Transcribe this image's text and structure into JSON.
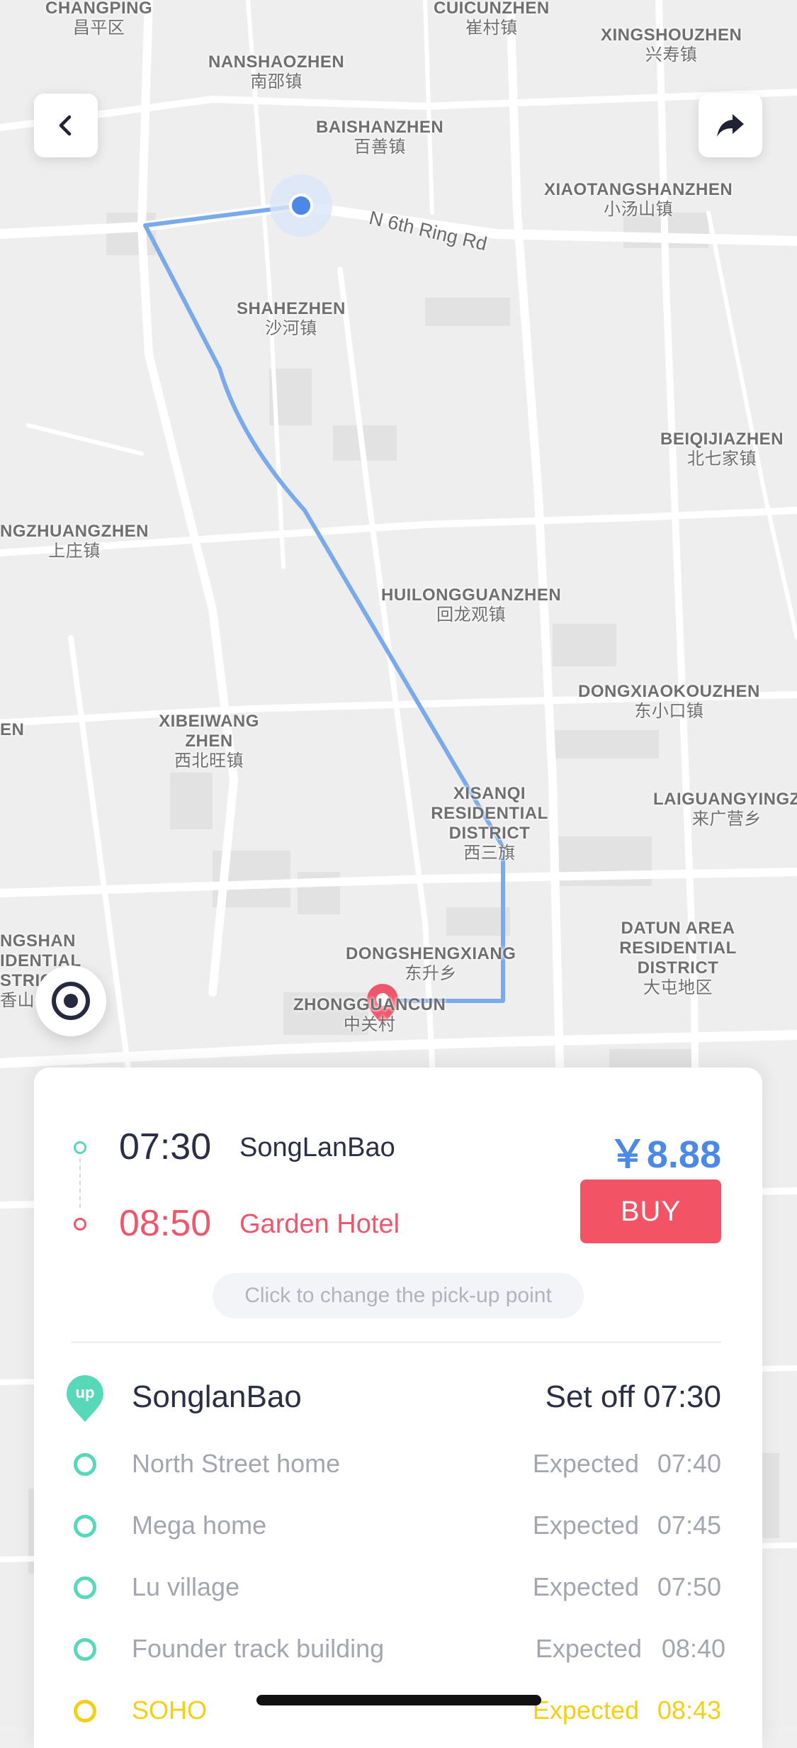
{
  "map": {
    "places": [
      {
        "en": "CHANGPING",
        "cn": "昌平区"
      },
      {
        "en": "CUICUNZHEN",
        "cn": "崔村镇"
      },
      {
        "en": "XINGSHOUZHEN",
        "cn": "兴寿镇"
      },
      {
        "en": "NANSHAOZHEN",
        "cn": "南邵镇"
      },
      {
        "en": "BAISHANZHEN",
        "cn": "百善镇"
      },
      {
        "en": "XIAOTANGSHANZHEN",
        "cn": "小汤山镇"
      },
      {
        "en": "SHAHEZHEN",
        "cn": "沙河镇"
      },
      {
        "en": "BEIQIJIAZHEN",
        "cn": "北七家镇"
      },
      {
        "en": "NGZHUANGZHEN",
        "cn": "上庄镇"
      },
      {
        "en": "HUILONGGUANZHEN",
        "cn": "回龙观镇"
      },
      {
        "en": "DONGXIAOKOUZHEN",
        "cn": "东小口镇"
      },
      {
        "en": "XIBEIWANG ZHEN",
        "cn": "西北旺镇"
      },
      {
        "en": "XISANQI RESIDENTIAL DISTRICT",
        "cn": "西三旗"
      },
      {
        "en": "LAIGUANGYINGZ",
        "cn": "来广营乡"
      },
      {
        "en": "NGSHAN IDENTIAL STRIC",
        "cn": "香山"
      },
      {
        "en": "DONGSHENGXIANG",
        "cn": "东升乡"
      },
      {
        "en": "DATUN AREA RESIDENTIAL DISTRICT",
        "cn": "大屯地区"
      },
      {
        "en": "ZHONGGUANCUN",
        "cn": "中关村"
      },
      {
        "en": "EN",
        "cn": ""
      }
    ],
    "road": "N 6th Ring Rd"
  },
  "trip": {
    "depart_time": "07:30",
    "depart_place": "SongLanBao",
    "arrive_time": "08:50",
    "arrive_place": "Garden Hotel",
    "price": "￥8.88",
    "buy_label": "BUY",
    "change_pickup": "Click to change the pick-up point"
  },
  "route": {
    "start_badge": "up",
    "first_stop": {
      "name": "SonglanBao",
      "label": "Set off",
      "time": "07:30"
    },
    "stops": [
      {
        "name": "North Street home",
        "label": "Expected",
        "time": "07:40",
        "highlight": false
      },
      {
        "name": "Mega home",
        "label": "Expected",
        "time": "07:45",
        "highlight": false
      },
      {
        "name": "Lu village",
        "label": "Expected",
        "time": "07:50",
        "highlight": false
      },
      {
        "name": "Founder track building",
        "label": "Expected",
        "time": "08:40",
        "highlight": false
      },
      {
        "name": "SOHO",
        "label": "Expected",
        "time": "08:43",
        "highlight": true
      }
    ]
  },
  "colors": {
    "route_line": "#7aa9ec",
    "accent_blue": "#4a8ae6",
    "accent_red": "#f25465",
    "stop_green": "#57d8b8",
    "stop_yellow": "#f5cf14"
  },
  "icons": {
    "back": "chevron-left-icon",
    "share": "share-arrow-icon",
    "locate": "locate-target-icon",
    "pickup": "up-pin-icon"
  }
}
